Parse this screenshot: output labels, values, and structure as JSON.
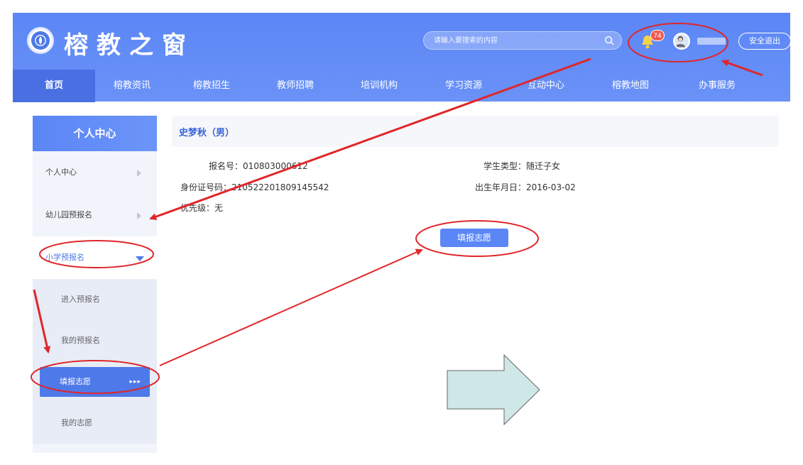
{
  "header": {
    "brand": "榕教之窗",
    "search_placeholder": "请输入要搜索的内容",
    "notification_count": "74",
    "username": "",
    "logout_label": "安全退出"
  },
  "nav": {
    "items": [
      {
        "label": "首页",
        "active": true
      },
      {
        "label": "榕教资讯"
      },
      {
        "label": "榕教招生"
      },
      {
        "label": "教师招聘"
      },
      {
        "label": "培训机构"
      },
      {
        "label": "学习资源"
      },
      {
        "label": "互动中心"
      },
      {
        "label": "榕教地图"
      },
      {
        "label": "办事服务"
      }
    ]
  },
  "sidebar": {
    "title": "个人中心",
    "items": [
      {
        "label": "个人中心"
      },
      {
        "label": "幼儿园预报名"
      },
      {
        "label": "小学预报名"
      }
    ],
    "sub_items": [
      {
        "label": "进入预报名"
      },
      {
        "label": "我的预报名"
      },
      {
        "label": "填报志愿",
        "arrows": "▸▸▸"
      },
      {
        "label": "我的志愿"
      }
    ]
  },
  "student": {
    "name": "史梦秋（男）",
    "reg_no": "报名号：010803000612",
    "id_no": "身份证号码：210522201809145542",
    "priority": "优先级：无",
    "type": "学生类型：随迁子女",
    "birth": "出生年月日：2016-03-02"
  },
  "actions": {
    "fill_label": "填报志愿"
  },
  "colors": {
    "brand_blue": "#5b86f6",
    "annotation_red": "#e0262a",
    "arrow_fill": "#cfe7e7"
  }
}
